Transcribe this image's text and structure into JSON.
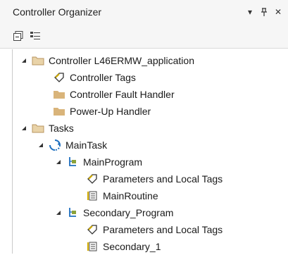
{
  "panel": {
    "title": "Controller Organizer",
    "pin_label": "↕",
    "close_label": "✕",
    "dropdown_label": "▾"
  },
  "tree": {
    "controller": {
      "label": "Controller L46ERMW_application",
      "icon": "folder-open-icon"
    },
    "controller_tags": {
      "label": "Controller Tags",
      "icon": "tag-icon"
    },
    "fault_handler": {
      "label": "Controller Fault Handler",
      "icon": "folder-icon"
    },
    "powerup_handler": {
      "label": "Power-Up Handler",
      "icon": "folder-icon"
    },
    "tasks": {
      "label": "Tasks",
      "icon": "folder-open-icon"
    },
    "main_task": {
      "label": "MainTask",
      "icon": "task-cycle-icon"
    },
    "main_program": {
      "label": "MainProgram",
      "icon": "program-icon"
    },
    "main_params": {
      "label": "Parameters and Local Tags",
      "icon": "tag-icon"
    },
    "main_routine": {
      "label": "MainRoutine",
      "icon": "routine-icon"
    },
    "secondary_program": {
      "label": "Secondary_Program",
      "icon": "program-icon"
    },
    "secondary_params": {
      "label": "Parameters and Local Tags",
      "icon": "tag-icon"
    },
    "secondary_routine": {
      "label": "Secondary_1",
      "icon": "routine-icon"
    }
  },
  "colors": {
    "folder": "#d9b47a",
    "tag": "#c9a400",
    "task": "#1e6fbf",
    "program": "#6b7b2a"
  }
}
